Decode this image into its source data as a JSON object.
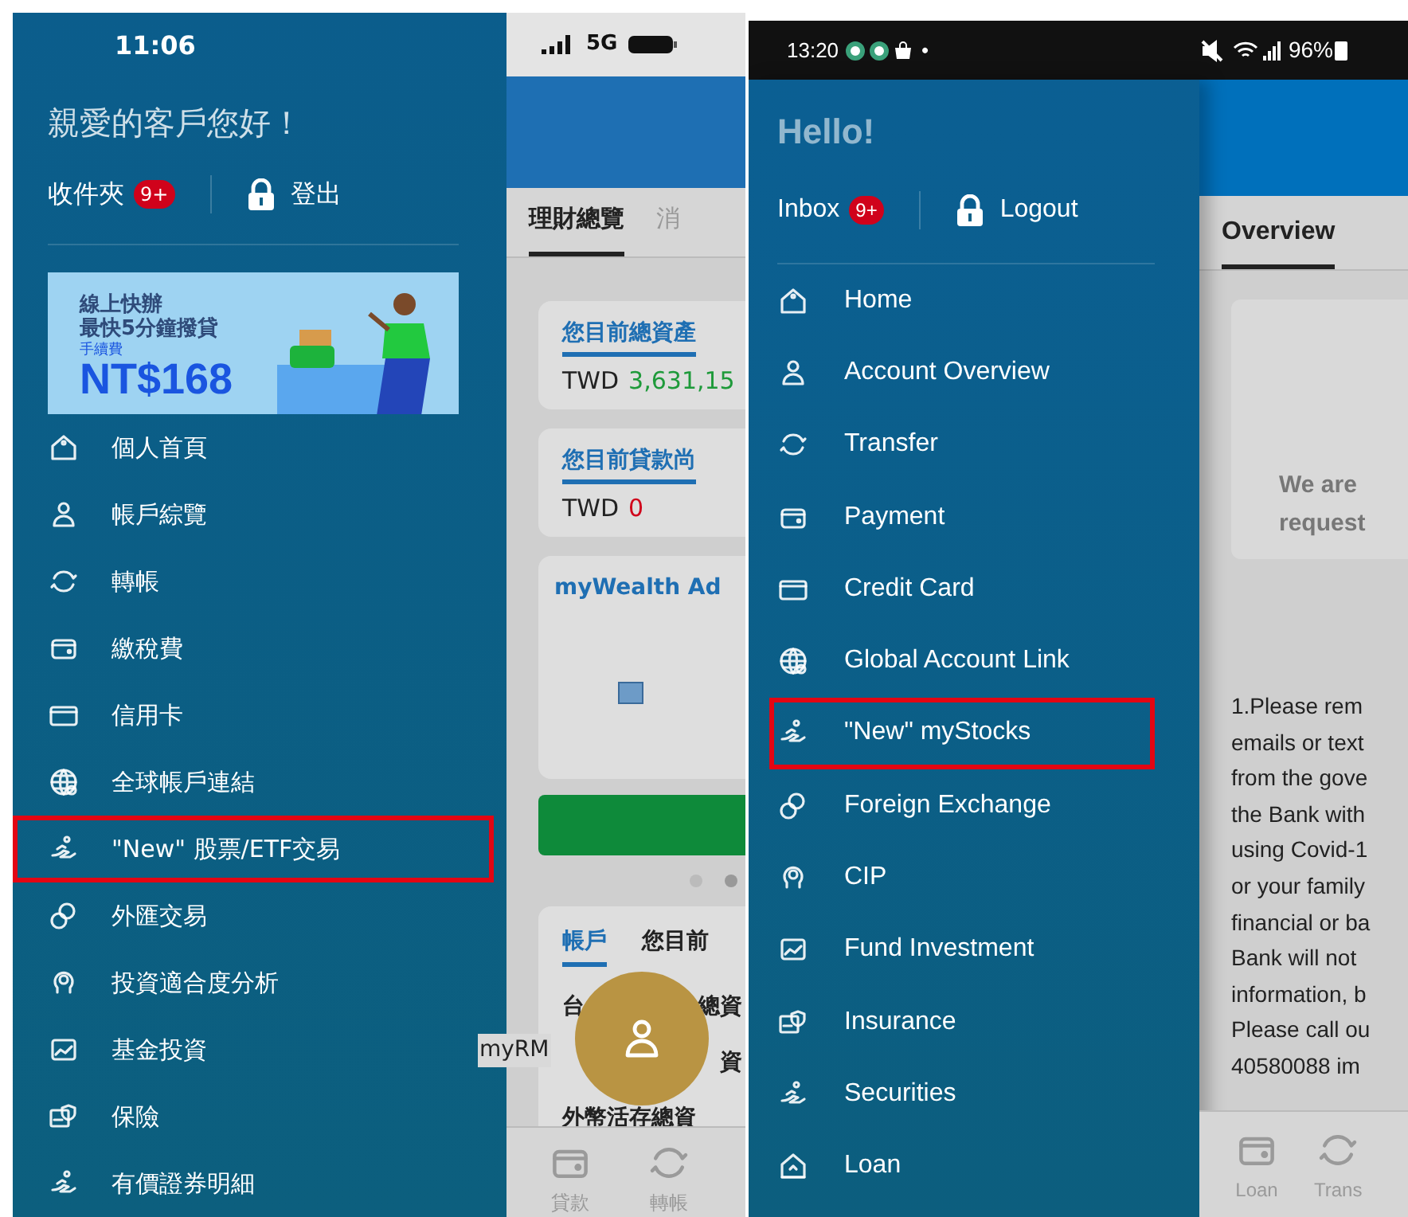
{
  "left_screen": {
    "status_bar": {
      "time": "11:06",
      "network": "5G"
    },
    "drawer": {
      "greeting": "親愛的客戶您好！",
      "inbox": {
        "label": "收件夾",
        "badge": "9+"
      },
      "logout": "登出",
      "banner": {
        "tagline": "線上快辦",
        "headline": "最快5分鐘撥貸",
        "fee_label": "手續費",
        "price": "NT$168"
      },
      "items": [
        {
          "label": "個人首頁",
          "kind": "home",
          "highlighted": false
        },
        {
          "label": "帳戶綜覽",
          "kind": "person",
          "highlighted": false
        },
        {
          "label": "轉帳",
          "kind": "transfer",
          "highlighted": false
        },
        {
          "label": "繳稅費",
          "kind": "wallet",
          "highlighted": false
        },
        {
          "label": "信用卡",
          "kind": "card",
          "highlighted": false
        },
        {
          "label": "全球帳戶連結",
          "kind": "globe",
          "highlighted": false
        },
        {
          "label": "\"New\" 股票/ETF交易",
          "kind": "stocks",
          "highlighted": true
        },
        {
          "label": "外匯交易",
          "kind": "exchange",
          "highlighted": false
        },
        {
          "label": "投資適合度分析",
          "kind": "head",
          "highlighted": false
        },
        {
          "label": "基金投資",
          "kind": "fund",
          "highlighted": false
        },
        {
          "label": "保險",
          "kind": "insurance",
          "highlighted": false
        },
        {
          "label": "有價證券明細",
          "kind": "stocks",
          "highlighted": false
        }
      ]
    },
    "content": {
      "tabs": [
        {
          "label": "理財總覽",
          "selected": true
        },
        {
          "label": "消",
          "selected": false
        }
      ],
      "cards": [
        {
          "title": "您目前總資產",
          "currency": "TWD",
          "amount": "3,631,15",
          "kind": "positive"
        },
        {
          "title": "您目前貸款尚",
          "currency": "TWD",
          "amount": "0",
          "kind": "negative"
        }
      ],
      "promo_title": "myWealth Ad",
      "account_tabs": [
        {
          "label": "帳戶",
          "selected": true
        },
        {
          "label": "您目前",
          "selected": false
        }
      ],
      "account_rows": [
        {
          "left": "台",
          "right": "總資"
        },
        {
          "right": "資"
        },
        {
          "left": "外幣活存總資"
        }
      ],
      "fab_label": "myRM",
      "nav": [
        {
          "label": "貸款",
          "kind": "wallet"
        },
        {
          "label": "轉帳",
          "kind": "transfer"
        }
      ]
    }
  },
  "right_screen": {
    "status_bar": {
      "time": "13:20",
      "dot": "•",
      "battery": "96%"
    },
    "drawer": {
      "greeting": "Hello!",
      "inbox": {
        "label": "Inbox",
        "badge": "9+"
      },
      "logout": "Logout",
      "items": [
        {
          "label": "Home",
          "kind": "home",
          "highlighted": false
        },
        {
          "label": "Account Overview",
          "kind": "person",
          "highlighted": false
        },
        {
          "label": "Transfer",
          "kind": "transfer",
          "highlighted": false
        },
        {
          "label": "Payment",
          "kind": "wallet",
          "highlighted": false
        },
        {
          "label": "Credit Card",
          "kind": "card",
          "highlighted": false
        },
        {
          "label": "Global Account Link",
          "kind": "globe",
          "highlighted": false
        },
        {
          "label": "\"New\" myStocks",
          "kind": "stocks",
          "highlighted": true
        },
        {
          "label": "Foreign Exchange",
          "kind": "exchange",
          "highlighted": false
        },
        {
          "label": "CIP",
          "kind": "head",
          "highlighted": false
        },
        {
          "label": "Fund Investment",
          "kind": "fund",
          "highlighted": false
        },
        {
          "label": "Insurance",
          "kind": "insurance",
          "highlighted": false
        },
        {
          "label": "Securities",
          "kind": "stocks",
          "highlighted": false
        },
        {
          "label": "Loan",
          "kind": "house",
          "highlighted": false
        }
      ]
    },
    "content": {
      "tabs": [
        {
          "label": "Overview",
          "selected": true
        }
      ],
      "card_lines": [
        "We are",
        "request"
      ],
      "notice_lines": [
        "1.Please rem",
        "emails or text",
        "from the gove",
        "the Bank with",
        "using Covid-1",
        "or your family",
        "financial or ba",
        "Bank will not",
        "information, b",
        "Please call ou",
        "40580088 im"
      ],
      "nav": [
        {
          "label": "Loan",
          "kind": "wallet"
        },
        {
          "label": "Trans",
          "kind": "transfer"
        }
      ]
    }
  }
}
